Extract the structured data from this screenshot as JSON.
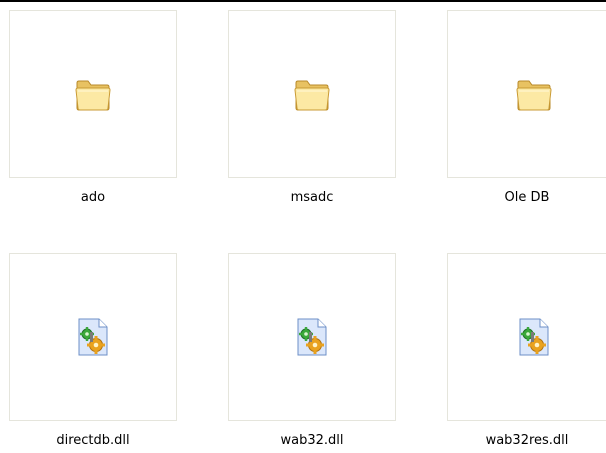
{
  "folder_view": {
    "items": [
      {
        "label": "ado",
        "type": "folder",
        "icon": "folder-icon"
      },
      {
        "label": "msadc",
        "type": "folder",
        "icon": "folder-icon"
      },
      {
        "label": "Ole DB",
        "type": "folder",
        "icon": "folder-icon"
      },
      {
        "label": "directdb.dll",
        "type": "dll",
        "icon": "dll-file-icon"
      },
      {
        "label": "wab32.dll",
        "type": "dll",
        "icon": "dll-file-icon"
      },
      {
        "label": "wab32res.dll",
        "type": "dll",
        "icon": "dll-file-icon"
      }
    ]
  },
  "colors": {
    "folder_light": "#fce9a4",
    "folder_dark": "#e1b44b",
    "thumb_border": "#e5e5dc",
    "dll_page": "#dbe7fb",
    "gear_orange": "#e9a21f",
    "gear_green": "#3aa83a"
  }
}
